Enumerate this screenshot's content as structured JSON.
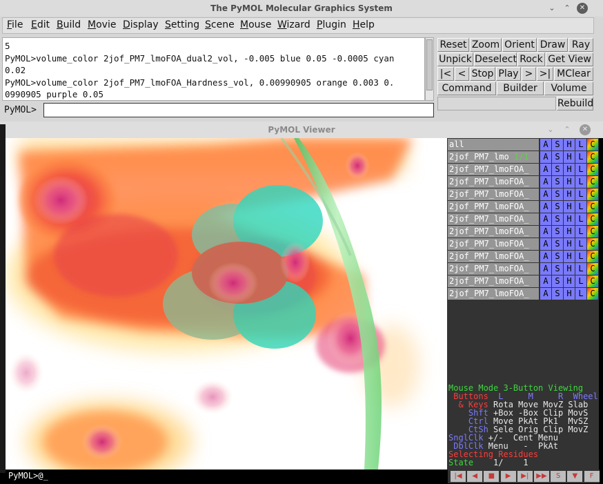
{
  "main_window": {
    "title": "The PyMOL Molecular Graphics System",
    "controls": {
      "minimize": "⌄",
      "maximize": "⌃",
      "close": "✕"
    }
  },
  "menu": [
    {
      "ul": "F",
      "rest": "ile"
    },
    {
      "ul": "E",
      "rest": "dit"
    },
    {
      "ul": "B",
      "rest": "uild"
    },
    {
      "ul": "M",
      "rest": "ovie"
    },
    {
      "ul": "D",
      "rest": "isplay"
    },
    {
      "ul": "S",
      "rest": "etting"
    },
    {
      "ul": "S",
      "rest": "cene"
    },
    {
      "ul": "M",
      "rest": "ouse"
    },
    {
      "ul": "W",
      "rest": "izard"
    },
    {
      "ul": "P",
      "rest": "lugin"
    },
    {
      "ul": "H",
      "rest": "elp"
    }
  ],
  "output_lines": [
    "5",
    "PyMOL>volume_color 2jof_PM7_lmoFOA_dual2_vol, -0.005 blue 0.05 -0.0005 cyan",
    "0.02",
    "PyMOL>volume_color 2jof_PM7_lmoFOA_Hardness_vol, 0.00990905 orange 0.003 0.",
    "0990905 purple 0.05"
  ],
  "command": {
    "label": "PyMOL>",
    "value": ""
  },
  "toolbar": {
    "row1": [
      "Reset",
      "Zoom",
      "Orient",
      "Draw",
      "Ray"
    ],
    "row2": [
      "Unpick",
      "Deselect",
      "Rock",
      "Get View"
    ],
    "row3": [
      "|<",
      "<",
      "Stop",
      "Play",
      ">",
      ">|",
      "MClear"
    ],
    "row4": [
      "Command",
      "Builder",
      "Volume"
    ],
    "rebuild": "Rebuild"
  },
  "viewer_window": {
    "title": "PyMOL Viewer",
    "controls": {
      "minimize": "⌄",
      "maximize": "⌃",
      "close": "✕"
    },
    "prompt": "PyMOL>@_"
  },
  "objects": {
    "all": {
      "name": "all"
    },
    "list": [
      {
        "name": "2jof_PM7_lmo",
        "state": "1/1"
      },
      {
        "name": "2jof_PM7_lmoFOA_"
      },
      {
        "name": "2jof_PM7_lmoFOA_"
      },
      {
        "name": "2jof_PM7_lmoFOA_"
      },
      {
        "name": "2jof_PM7_lmoFOA_"
      },
      {
        "name": "2jof_PM7_lmoFOA_"
      },
      {
        "name": "2jof_PM7_lmoFOA_"
      },
      {
        "name": "2jof_PM7_lmoFOA_"
      },
      {
        "name": "2jof_PM7_lmoFOA_"
      },
      {
        "name": "2jof_PM7_lmoFOA_"
      },
      {
        "name": "2jof_PM7_lmoFOA_"
      },
      {
        "name": "2jof_PM7_lmoFOA_"
      }
    ],
    "buttons": [
      "A",
      "S",
      "H",
      "L",
      "C"
    ]
  },
  "mouse_info": {
    "line1": {
      "a": "Mouse Mode ",
      "b": "3-Button Viewing"
    },
    "line2": {
      "a": " Buttons  ",
      "b": "L     M     R  Wheel"
    },
    "line3": {
      "a": "  & Keys ",
      "b": "Rota Move MovZ Slab"
    },
    "line4": {
      "a": "    Shft ",
      "b": "+Box -Box Clip MovS"
    },
    "line5": {
      "a": "    Ctrl ",
      "b": "Move PkAt Pk1  MvSZ"
    },
    "line6": {
      "a": "    CtSh ",
      "b": "Sele Orig Clip MovZ"
    },
    "line7": {
      "a": "SnglClk ",
      "b": "+/-  Cent Menu"
    },
    "line8": {
      "a": " DblClk ",
      "b": "Menu   -  PkAt"
    },
    "line9": {
      "a": "Selecting Residues"
    },
    "line10": {
      "a": "State ",
      "b": "   1/    1"
    }
  },
  "playback": [
    "|◀",
    "◀",
    "■",
    "▶",
    "▶|",
    "▶▶",
    "S",
    "▼",
    "F"
  ],
  "colors": {
    "orange": "#ff5a1e",
    "magenta": "#e0307a",
    "cyan": "#28d8c0",
    "green_ribbon": "#7ddf8a",
    "panel_blue": "#7a7aff"
  }
}
